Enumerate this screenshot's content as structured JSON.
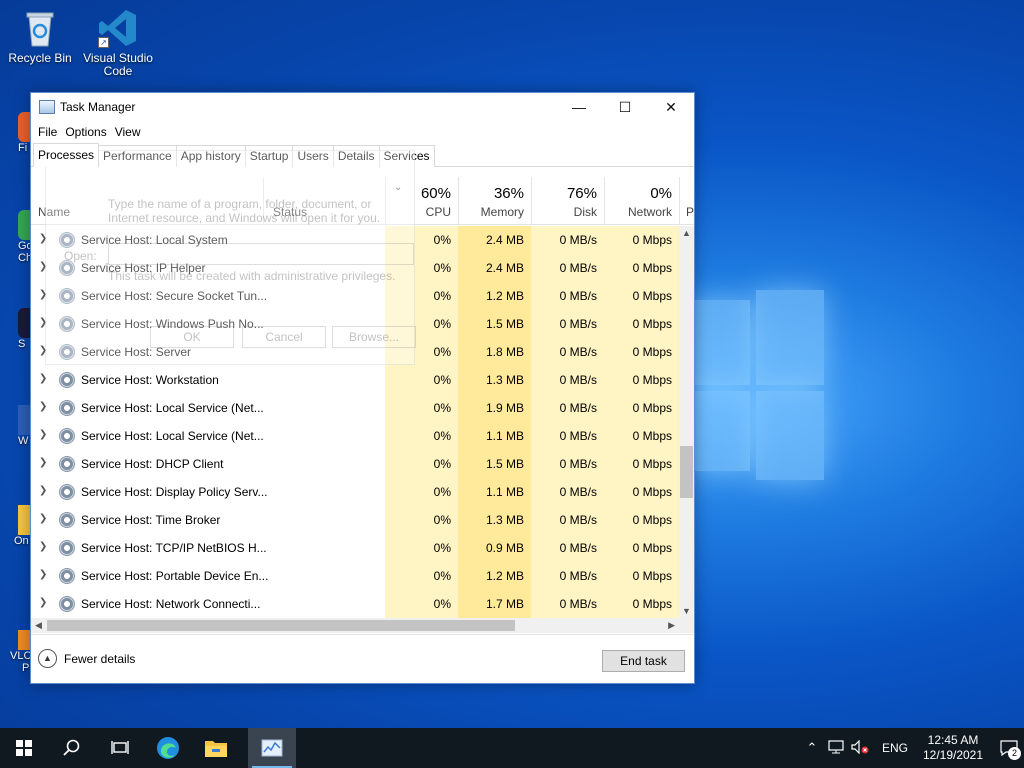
{
  "desktop": {
    "icons": [
      {
        "label": "Recycle Bin"
      },
      {
        "label": "Visual Studio Code"
      }
    ],
    "side_labels": [
      "Fi",
      "Go",
      "Ch",
      "S",
      "W",
      "On",
      "VLC",
      "P"
    ]
  },
  "window": {
    "title": "Task Manager",
    "controls": {
      "minimize": "—",
      "maximize": "☐",
      "close": "✕"
    },
    "menu": [
      "File",
      "Options",
      "View"
    ],
    "tabs": [
      "Processes",
      "Performance",
      "App history",
      "Startup",
      "Users",
      "Details",
      "Services"
    ],
    "columns": {
      "name": "Name",
      "status": "Status",
      "cpu": {
        "pct": "60%",
        "label": "CPU"
      },
      "memory": {
        "pct": "36%",
        "label": "Memory"
      },
      "disk": {
        "pct": "76%",
        "label": "Disk"
      },
      "network": {
        "pct": "0%",
        "label": "Network"
      },
      "power_peek": "P"
    },
    "processes": [
      {
        "name": "Service Host: Local System",
        "cpu": "0%",
        "memory": "2.4 MB",
        "disk": "0 MB/s",
        "network": "0 Mbps"
      },
      {
        "name": "Service Host: IP Helper",
        "cpu": "0%",
        "memory": "2.4 MB",
        "disk": "0 MB/s",
        "network": "0 Mbps"
      },
      {
        "name": "Service Host: Secure Socket Tun...",
        "cpu": "0%",
        "memory": "1.2 MB",
        "disk": "0 MB/s",
        "network": "0 Mbps"
      },
      {
        "name": "Service Host: Windows Push No...",
        "cpu": "0%",
        "memory": "1.5 MB",
        "disk": "0 MB/s",
        "network": "0 Mbps"
      },
      {
        "name": "Service Host: Server",
        "cpu": "0%",
        "memory": "1.8 MB",
        "disk": "0 MB/s",
        "network": "0 Mbps"
      },
      {
        "name": "Service Host: Workstation",
        "cpu": "0%",
        "memory": "1.3 MB",
        "disk": "0 MB/s",
        "network": "0 Mbps"
      },
      {
        "name": "Service Host: Local Service (Net...",
        "cpu": "0%",
        "memory": "1.9 MB",
        "disk": "0 MB/s",
        "network": "0 Mbps"
      },
      {
        "name": "Service Host: Local Service (Net...",
        "cpu": "0%",
        "memory": "1.1 MB",
        "disk": "0 MB/s",
        "network": "0 Mbps"
      },
      {
        "name": "Service Host: DHCP Client",
        "cpu": "0%",
        "memory": "1.5 MB",
        "disk": "0 MB/s",
        "network": "0 Mbps"
      },
      {
        "name": "Service Host: Display Policy Serv...",
        "cpu": "0%",
        "memory": "1.1 MB",
        "disk": "0 MB/s",
        "network": "0 Mbps"
      },
      {
        "name": "Service Host: Time Broker",
        "cpu": "0%",
        "memory": "1.3 MB",
        "disk": "0 MB/s",
        "network": "0 Mbps"
      },
      {
        "name": "Service Host: TCP/IP NetBIOS H...",
        "cpu": "0%",
        "memory": "0.9 MB",
        "disk": "0 MB/s",
        "network": "0 Mbps"
      },
      {
        "name": "Service Host: Portable Device En...",
        "cpu": "0%",
        "memory": "1.2 MB",
        "disk": "0 MB/s",
        "network": "0 Mbps"
      },
      {
        "name": "Service Host: Network Connecti...",
        "cpu": "0%",
        "memory": "1.7 MB",
        "disk": "0 MB/s",
        "network": "0 Mbps"
      }
    ],
    "footer": {
      "fewer_details": "Fewer details",
      "end_task": "End task"
    }
  },
  "ghost_dialog": {
    "text": "Type the name of a program, folder, document, or Internet resource, and Windows will open it for you.",
    "open_label": "Open:",
    "admin_text": "This task will be created with administrative privileges.",
    "ok": "OK",
    "cancel": "Cancel",
    "browse": "Browse..."
  },
  "taskbar": {
    "icons": [
      "windows-start-icon",
      "search-icon",
      "task-view-icon",
      "edge-icon",
      "file-explorer-icon",
      "task-manager-icon"
    ],
    "lang": "ENG",
    "time": "12:45 AM",
    "date": "12/19/2021",
    "notification_count": "2"
  },
  "colors": {
    "accent": "#0a56c7",
    "cpu_bg": "#fff4c4",
    "memory_bg": "#ffe99a",
    "taskbar": "#101820"
  }
}
